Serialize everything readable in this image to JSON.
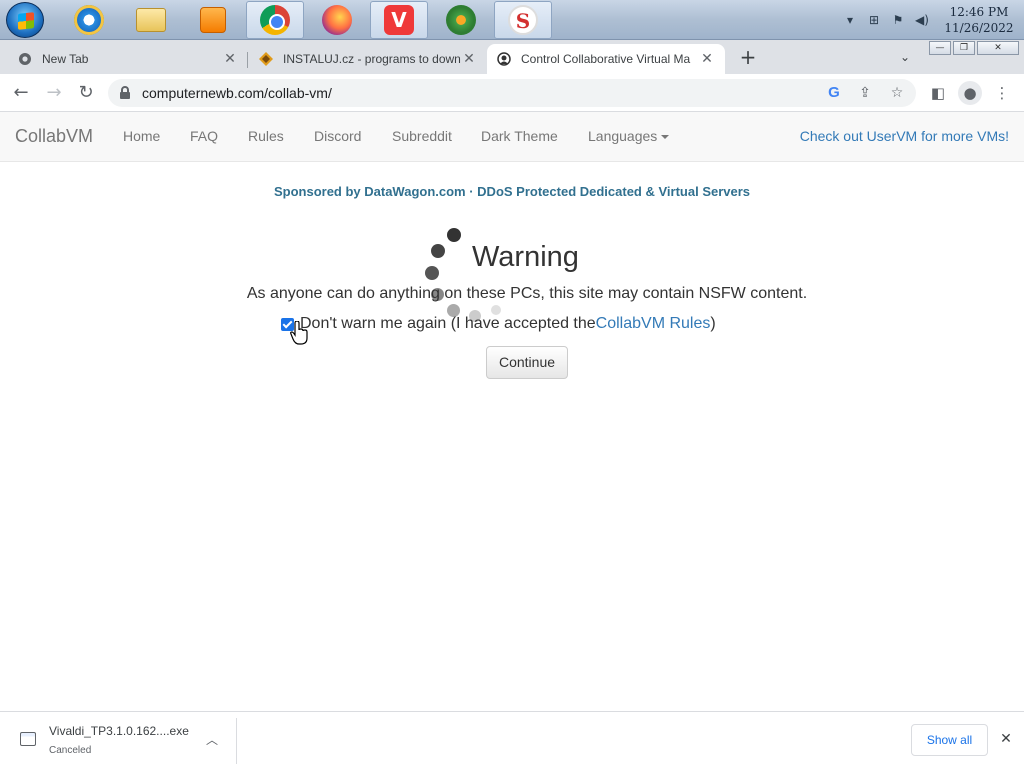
{
  "taskbar": {
    "apps": [
      {
        "name": "internet-explorer-icon"
      },
      {
        "name": "windows-explorer-icon"
      },
      {
        "name": "media-player-icon"
      },
      {
        "name": "chrome-icon"
      },
      {
        "name": "firefox-icon"
      },
      {
        "name": "vivaldi-icon"
      },
      {
        "name": "icq-icon"
      },
      {
        "name": "s-app-icon"
      }
    ],
    "clock_time": "12:46 PM",
    "clock_date": "11/26/2022"
  },
  "browser": {
    "tabs": [
      {
        "title": "New Tab",
        "close": "✕"
      },
      {
        "title": "INSTALUJ.cz - programs to down",
        "close": "✕"
      },
      {
        "title": "Control Collaborative Virtual Ma",
        "close": "✕"
      }
    ],
    "new_tab": "+",
    "url": "computernewb.com/collab-vm/"
  },
  "site": {
    "brand": "CollabVM",
    "nav": [
      "Home",
      "FAQ",
      "Rules",
      "Discord",
      "Subreddit",
      "Dark Theme",
      "Languages"
    ],
    "nav_right": "Check out UserVM for more VMs!",
    "sponsor": "Sponsored by DataWagon.com · DDoS Protected Dedicated & Virtual Servers",
    "warning_title": "Warning",
    "warning_text": "As anyone can do anything on these PCs, this site may contain NSFW content.",
    "checkbox_label_pre": "Don't warn me again (I have accepted the ",
    "checkbox_link": "CollabVM Rules",
    "checkbox_label_post": ")",
    "checkbox_checked": true,
    "continue_label": "Continue"
  },
  "downloads": {
    "file_name": "Vivaldi_TP3.1.0.162....exe",
    "status": "Canceled",
    "show_all": "Show all"
  }
}
